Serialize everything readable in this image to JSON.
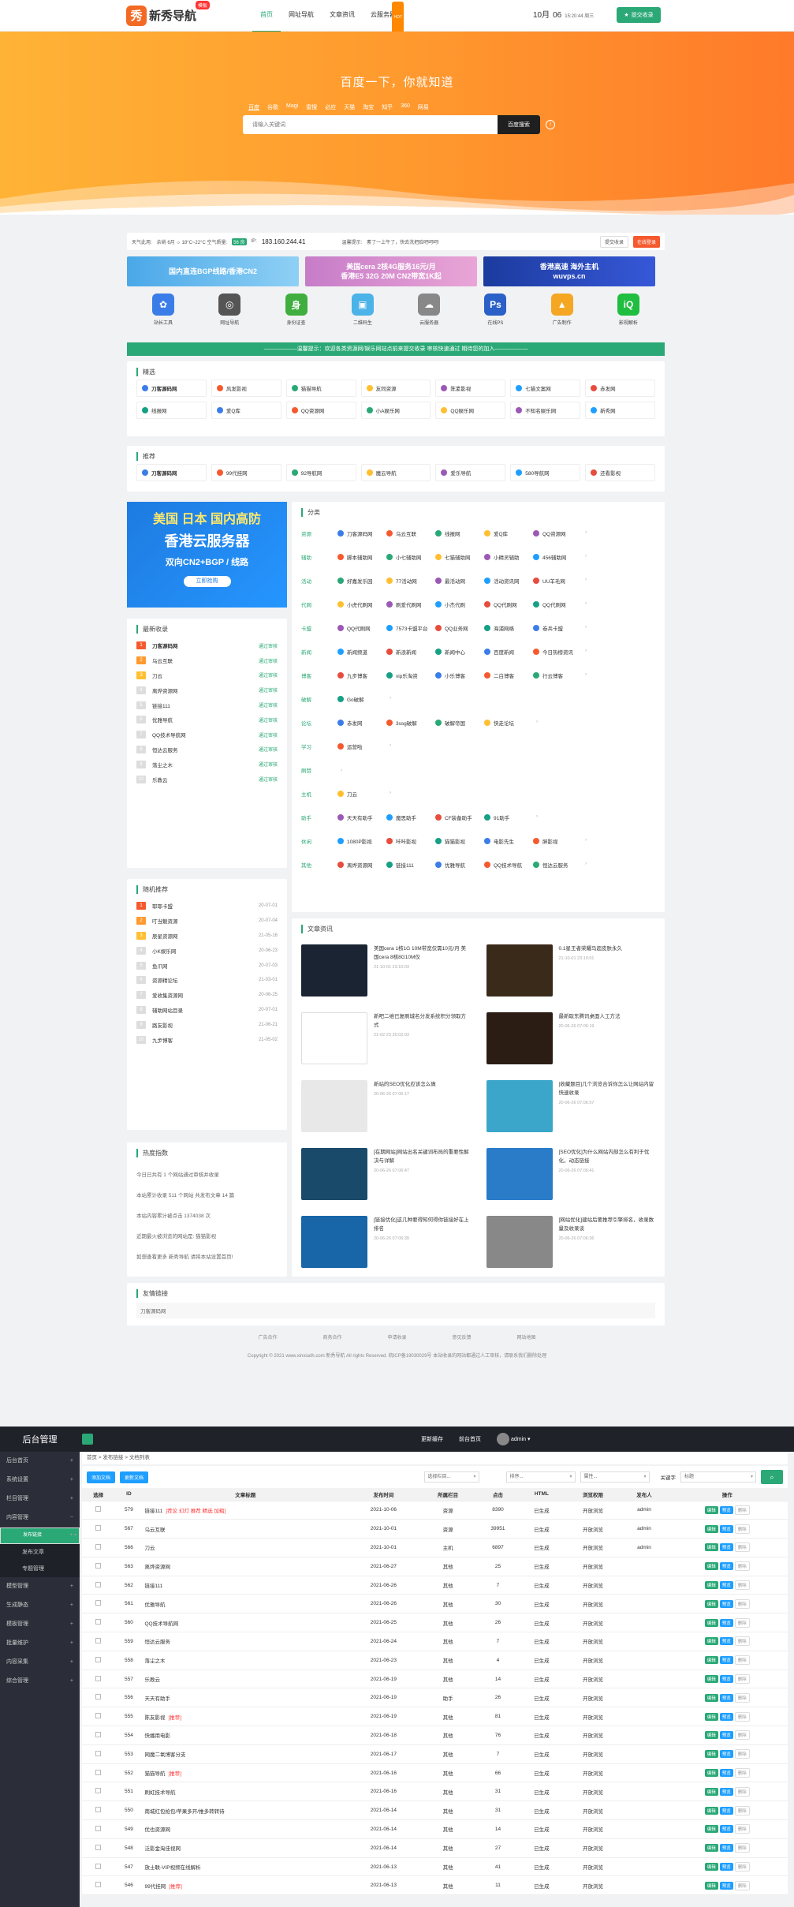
{
  "topbar": {
    "logo_mark": "秀",
    "logo_text": "新秀导航",
    "logo_badge": "模板",
    "nav": [
      "首页",
      "网址导航",
      "文章资讯",
      "云服务器"
    ],
    "nav_hot": "HOT",
    "date_month": "10月",
    "date_day": "06",
    "date_time": "15:20:44 周三",
    "submit_label": "提交收录"
  },
  "hero": {
    "title": "百度一下，你就知道",
    "engines": [
      "百度",
      "谷歌",
      "Magi",
      "雷搜",
      "必应",
      "天猫",
      "淘宝",
      "知乎",
      "360",
      "网易"
    ],
    "search_placeholder": "请输入关键词",
    "search_button": "百度搜索"
  },
  "infobar": {
    "weather_label": "天气此用:",
    "weather": "余姚 6月 ☼ 18°C~22°C 空气质量:",
    "aqi": "56 良",
    "ip_label": "IP:",
    "ip": "183.160.244.41",
    "tip_label": "温馨提示:",
    "tip": "素了一上午了，快去洗把脸吧呵呵!",
    "btn_edit": "提交收录",
    "btn_login": "在线登录"
  },
  "banners": [
    {
      "t1": "国内直连BGP线路/香港CN2",
      "t2": ""
    },
    {
      "t1": "美国cera 2核4G服务16元/月",
      "t2": "香港E5 32G 20M CN2带宽1K起"
    },
    {
      "t1": "香港高速 海外主机",
      "t2": "wuvps.cn"
    }
  ],
  "tools": [
    {
      "name": "站长工具",
      "icon": "paw-icon",
      "color": "#3b7de8",
      "g": "✿"
    },
    {
      "name": "网址导航",
      "icon": "compass-icon",
      "color": "#555",
      "g": "◎"
    },
    {
      "name": "身份证查",
      "icon": "id-icon",
      "color": "#3fae3f",
      "g": "身"
    },
    {
      "name": "二维码生",
      "icon": "qrcode-icon",
      "color": "#4bb3e8",
      "g": "▣"
    },
    {
      "name": "云服务器",
      "icon": "cloud-icon",
      "color": "#888",
      "g": "☁"
    },
    {
      "name": "在线PS",
      "icon": "ps-icon",
      "color": "#2a60c8",
      "g": "Ps"
    },
    {
      "name": "广告制作",
      "icon": "image-icon",
      "color": "#f5a623",
      "g": "▲"
    },
    {
      "name": "影视解析",
      "icon": "iqiyi-icon",
      "color": "#1fbe40",
      "g": "iQ"
    }
  ],
  "notice": "——————温馨提示：欢迎各类资源网/娱乐网站点前来提交收录 审核快速通过 期待您的加入——————",
  "featured": {
    "title": "精选",
    "items": [
      "刀客源码网",
      "风发影视",
      "猫猫导航",
      "友同资源",
      "陈素影视",
      "七猫文案网",
      "赤发网",
      "线报网",
      "爱Q库",
      "QQ资源网",
      "小A娱乐网",
      "QQ娱乐网",
      "不知名娱乐网",
      "新秀网"
    ]
  },
  "recommend": {
    "title": "推荐",
    "items": [
      "刀客源码网",
      "99代挂网",
      "92导航网",
      "魔云导航",
      "爱乐导航",
      "580导航网",
      "还看影视"
    ]
  },
  "ad": {
    "l1": "美国 日本 国内高防",
    "l2": "香港云服务器",
    "l3": "双向CN2+BGP / 线路",
    "l4": "立即抢购"
  },
  "latest": {
    "title": "最新收录",
    "items": [
      {
        "n": "刀客源码网",
        "s": "通过审核"
      },
      {
        "n": "乌云互联",
        "s": "通过审核"
      },
      {
        "n": "刀云",
        "s": "通过审核"
      },
      {
        "n": "离烨资源网",
        "s": "通过审核"
      },
      {
        "n": "链接111",
        "s": "通过审核"
      },
      {
        "n": "优雅导航",
        "s": "通过审核"
      },
      {
        "n": "QQ技术导航网",
        "s": "通过审核"
      },
      {
        "n": "恒达云服务",
        "s": "通过审核"
      },
      {
        "n": "落尘之木",
        "s": "通过审核"
      },
      {
        "n": "乐教云",
        "s": "通过审核"
      }
    ]
  },
  "random": {
    "title": "随机推荐",
    "items": [
      {
        "n": "耶耶卡盟",
        "d": "20-07-01"
      },
      {
        "n": "叮当魅资源",
        "d": "20-07-04"
      },
      {
        "n": "辰星资源网",
        "d": "21-05-16"
      },
      {
        "n": "小K娱乐网",
        "d": "20-06-23"
      },
      {
        "n": "鱼爪网",
        "d": "20-07-03"
      },
      {
        "n": "资源精论坛",
        "d": "21-03-01"
      },
      {
        "n": "爱收集资源网",
        "d": "20-06-25"
      },
      {
        "n": "辅助网站目录",
        "d": "20-07-01"
      },
      {
        "n": "路友影视",
        "d": "21-06-21"
      },
      {
        "n": "九步博客",
        "d": "21-05-02"
      }
    ]
  },
  "stats": {
    "title": "热度指数",
    "lines": [
      "今日已共有 1 个网站通过审核并收录",
      "本站累计收录 511 个网站 共发布文章 14 篇",
      "本站内容累计被点击 1374038 次",
      "近期最火被浏览的网站是: 猫猫影视",
      "如想查看更多 新秀导航 请将本站设置首页!"
    ]
  },
  "categories": {
    "title": "分类",
    "rows": [
      {
        "label": "资源",
        "items": [
          "刀客源码网",
          "乌云互联",
          "线报网",
          "爱Q库",
          "QQ资源网"
        ]
      },
      {
        "label": "辅助",
        "items": [
          "脚本辅助网",
          "小七辅助网",
          "七猫辅助网",
          "小精灵辅助",
          "456辅助网"
        ]
      },
      {
        "label": "活动",
        "items": [
          "好嘉发乐园",
          "77活动网",
          "最活动网",
          "活动资讯网",
          "UU羊毛网"
        ]
      },
      {
        "label": "代网",
        "items": [
          "小虎代刷网",
          "刷爱代刷网",
          "小杰代刷",
          "QQ代刷网",
          "QQ代刷网"
        ]
      },
      {
        "label": "卡盟",
        "items": [
          "QQ代刷网",
          "7573卡盟平台",
          "QQ业务网",
          "海浦网络",
          "卷兵卡盟"
        ]
      },
      {
        "label": "新闻",
        "items": [
          "新闻频道",
          "新浪新闻",
          "新闻中心",
          "百度新闻",
          "今日热榜资讯"
        ]
      },
      {
        "label": "博客",
        "items": [
          "九步博客",
          "vip乐淘资",
          "小乐博客",
          "二白博客",
          "行云博客"
        ]
      },
      {
        "label": "破解",
        "items": [
          "Go破解"
        ]
      },
      {
        "label": "论坛",
        "items": [
          "赤发网",
          "3ssg破解",
          "破解帝国",
          "快走论坛"
        ]
      },
      {
        "label": "学习",
        "items": [
          "运营啦"
        ]
      },
      {
        "label": "刷赞",
        "items": []
      },
      {
        "label": "主机",
        "items": [
          "刀云"
        ]
      },
      {
        "label": "助手",
        "items": [
          "天天有助手",
          "魔思助手",
          "CF装备助手",
          "91助手"
        ]
      },
      {
        "label": "休闲",
        "items": [
          "1080P影视",
          "咔咔影视",
          "猫猫影视",
          "电影先生",
          "胖影视"
        ]
      },
      {
        "label": "其他",
        "items": [
          "离烨资源网",
          "链接111",
          "优雅导航",
          "QQ技术导航",
          "恒达云服务"
        ]
      }
    ]
  },
  "articles": {
    "title": "文章资讯",
    "items": [
      {
        "t": "美国cera 1核1G 10M带宽仅需10元/月 美国cera 8核8G10M仅",
        "d": "21-10-01 23:10:03",
        "c": "#1a2433"
      },
      {
        "t": "0.1星王者荣耀马超皮肤永久",
        "d": "21-10-01 23:10:01",
        "c": "#3a2a1a"
      },
      {
        "t": "新吧二维已复刷城名分发系统积分领取方式",
        "d": "21-02-23 20:02:03",
        "c": "#ffffff"
      },
      {
        "t": "最新取东腾讯桌面人工方法",
        "d": "20-06-26 07:06:19",
        "c": "#2b1d14"
      },
      {
        "t": "新站的SEO优化应该怎么做",
        "d": "20-06-26 07:06:17",
        "c": "#e8e8e8"
      },
      {
        "t": "[收藏题目]几个浏览合诉你怎么让网站内留快速收录",
        "d": "20-06-26 07:06:57",
        "c": "#3ba6c9"
      },
      {
        "t": "[在期网站]网站出名关键词布局的重要性解决与详解",
        "d": "20-06-26 07:06:47",
        "c": "#1a4a6a"
      },
      {
        "t": "[SEO优化]为什么网站内部怎么有利于优化，动态链接",
        "d": "20-06-26 07:06:41",
        "c": "#2a7bc8"
      },
      {
        "t": "[链接优化]这几种要得知何得你链接好在上排名",
        "d": "20-06-26 07:06:39",
        "c": "#1866a8"
      },
      {
        "t": "[网站优化]建站后要推荐引擎排名，收录数量及收录谈",
        "d": "20-06-26 07:06:36",
        "c": "#888888"
      }
    ]
  },
  "friends": {
    "title": "友情链接",
    "items": [
      "刀客源码网"
    ]
  },
  "footer": {
    "links": [
      "广告合作",
      "商务合作",
      "申请收录",
      "意见反馈",
      "网站地图"
    ],
    "copy": "Copyright © 2021 www.xinxiudh.com 新秀导航 All rights Reserved. 皖ICP备19030029号 本站收录的网站都通过人工审核，请联系我们删除处理"
  },
  "admin": {
    "brand": "后台管理",
    "top_links": [
      "更新缓存",
      "前台首页",
      "admin"
    ],
    "menu": [
      {
        "l": "后台首页"
      },
      {
        "l": "系统设置"
      },
      {
        "l": "栏目管理"
      },
      {
        "l": "内容管理",
        "open": true
      },
      {
        "l": "发布链接",
        "sub": true,
        "sel": true
      },
      {
        "l": "发布文章",
        "sub": true
      },
      {
        "l": "专题管理",
        "sub": true
      },
      {
        "l": "模型管理"
      },
      {
        "l": "生成静态"
      },
      {
        "l": "模板管理"
      },
      {
        "l": "批量维护"
      },
      {
        "l": "内容采集"
      },
      {
        "l": "综合管理"
      }
    ],
    "crumb": [
      "首页",
      "发布链接",
      "文档列表"
    ],
    "buttons": [
      "添加文档",
      "更新文档"
    ],
    "filters": [
      "选择栏目...",
      "排序...",
      "属性...",
      "关键字",
      "标题"
    ],
    "columns": [
      "选择",
      "ID",
      "文章标题",
      "发布时间",
      "所属栏目",
      "点击",
      "HTML",
      "浏览权限",
      "发布人",
      "操作"
    ],
    "ops": [
      "编辑",
      "预览",
      "删除"
    ],
    "rows": [
      {
        "id": "579",
        "t": "链接111",
        "tag": "[荐论 幻灯 推荐 精选 加粗]",
        "date": "2021-10-06",
        "cat": "资源",
        "hits": "8390",
        "html": "已生成",
        "perm": "开放浏览",
        "user": "admin"
      },
      {
        "id": "567",
        "t": "乌云互联",
        "tag": "",
        "date": "2021-10-01",
        "cat": "资源",
        "hits": "39951",
        "html": "已生成",
        "perm": "开放浏览",
        "user": "admin"
      },
      {
        "id": "566",
        "t": "刀云",
        "tag": "",
        "date": "2021-10-01",
        "cat": "主机",
        "hits": "6897",
        "html": "已生成",
        "perm": "开放浏览",
        "user": "admin"
      },
      {
        "id": "563",
        "t": "离烨资源网",
        "tag": "",
        "date": "2021-06-27",
        "cat": "其他",
        "hits": "25",
        "html": "已生成",
        "perm": "开放浏览",
        "user": ""
      },
      {
        "id": "562",
        "t": "链接111",
        "tag": "",
        "date": "2021-06-26",
        "cat": "其他",
        "hits": "7",
        "html": "已生成",
        "perm": "开放浏览",
        "user": ""
      },
      {
        "id": "561",
        "t": "优雅导航",
        "tag": "",
        "date": "2021-06-26",
        "cat": "其他",
        "hits": "30",
        "html": "已生成",
        "perm": "开放浏览",
        "user": ""
      },
      {
        "id": "560",
        "t": "QQ技术导航网",
        "tag": "",
        "date": "2021-06-25",
        "cat": "其他",
        "hits": "26",
        "html": "已生成",
        "perm": "开放浏览",
        "user": ""
      },
      {
        "id": "559",
        "t": "恒达云服务",
        "tag": "",
        "date": "2021-06-24",
        "cat": "其他",
        "hits": "7",
        "html": "已生成",
        "perm": "开放浏览",
        "user": ""
      },
      {
        "id": "558",
        "t": "落尘之木",
        "tag": "",
        "date": "2021-06-23",
        "cat": "其他",
        "hits": "4",
        "html": "已生成",
        "perm": "开放浏览",
        "user": ""
      },
      {
        "id": "557",
        "t": "乐教云",
        "tag": "",
        "date": "2021-06-19",
        "cat": "其他",
        "hits": "14",
        "html": "已生成",
        "perm": "开放浏览",
        "user": ""
      },
      {
        "id": "556",
        "t": "天天有助手",
        "tag": "",
        "date": "2021-06-19",
        "cat": "助手",
        "hits": "26",
        "html": "已生成",
        "perm": "开放浏览",
        "user": ""
      },
      {
        "id": "555",
        "t": "陈友影视",
        "tag": "[推荐]",
        "date": "2021-06-19",
        "cat": "其他",
        "hits": "81",
        "html": "已生成",
        "perm": "开放浏览",
        "user": ""
      },
      {
        "id": "554",
        "t": "快播用电影",
        "tag": "",
        "date": "2021-06-18",
        "cat": "其他",
        "hits": "76",
        "html": "已生成",
        "perm": "开放浏览",
        "user": ""
      },
      {
        "id": "553",
        "t": "网魔二氧博客分支",
        "tag": "",
        "date": "2021-06-17",
        "cat": "其他",
        "hits": "7",
        "html": "已生成",
        "perm": "开放浏览",
        "user": ""
      },
      {
        "id": "552",
        "t": "猫猫导航",
        "tag": "[推荐]",
        "date": "2021-06-16",
        "cat": "其他",
        "hits": "66",
        "html": "已生成",
        "perm": "开放浏览",
        "user": ""
      },
      {
        "id": "551",
        "t": "刷虹技术导航",
        "tag": "",
        "date": "2021-06-16",
        "cat": "其他",
        "hits": "31",
        "html": "已生成",
        "perm": "开放浏览",
        "user": ""
      },
      {
        "id": "550",
        "t": "南城红包抢包/苹果多开/推多转转待",
        "tag": "",
        "date": "2021-06-14",
        "cat": "其他",
        "hits": "31",
        "html": "已生成",
        "perm": "开放浏览",
        "user": ""
      },
      {
        "id": "549",
        "t": "优也资源网",
        "tag": "",
        "date": "2021-06-14",
        "cat": "其他",
        "hits": "14",
        "html": "已生成",
        "perm": "开放浏览",
        "user": ""
      },
      {
        "id": "548",
        "t": "泛影金淘佳视网",
        "tag": "",
        "date": "2021-06-14",
        "cat": "其他",
        "hits": "27",
        "html": "已生成",
        "perm": "开放浏览",
        "user": ""
      },
      {
        "id": "547",
        "t": "放士联-VIP视频在线解析",
        "tag": "",
        "date": "2021-06-13",
        "cat": "其他",
        "hits": "41",
        "html": "已生成",
        "perm": "开放浏览",
        "user": ""
      },
      {
        "id": "546",
        "t": "99代挂网",
        "tag": "[推荐]",
        "date": "2021-06-13",
        "cat": "其他",
        "hits": "11",
        "html": "已生成",
        "perm": "开放浏览",
        "user": ""
      }
    ]
  }
}
